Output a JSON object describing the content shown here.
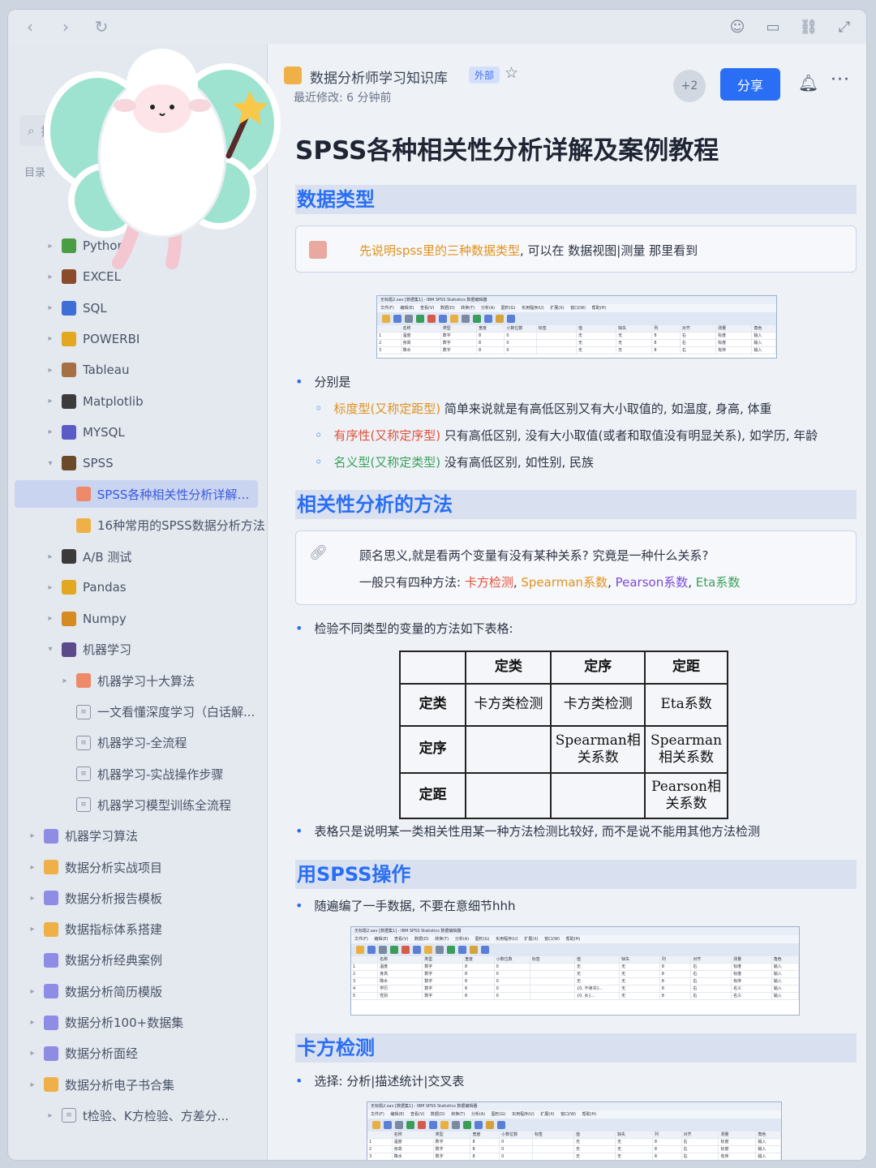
{
  "browser": {
    "back_icon": "back-icon",
    "forward_icon": "forward-icon",
    "refresh_icon": "refresh-icon"
  },
  "sidebar": {
    "search_label": "搜索",
    "toc_label": "目录",
    "items": [
      {
        "label": "Python",
        "level": 1,
        "arrow": "▸",
        "icon": "python-icon",
        "color": "#4a9d45"
      },
      {
        "label": "EXCEL",
        "level": 1,
        "arrow": "▸",
        "icon": "excel-icon",
        "color": "#8b4a2a"
      },
      {
        "label": "SQL",
        "level": 1,
        "arrow": "▸",
        "icon": "sql-icon",
        "color": "#3f6fd6"
      },
      {
        "label": "POWERBI",
        "level": 1,
        "arrow": "▸",
        "icon": "powerbi-icon",
        "color": "#e2a81f"
      },
      {
        "label": "Tableau",
        "level": 1,
        "arrow": "▸",
        "icon": "tableau-icon",
        "color": "#a57144"
      },
      {
        "label": "Matplotlib",
        "level": 1,
        "arrow": "▸",
        "icon": "matplotlib-icon",
        "color": "#3b3b3b"
      },
      {
        "label": "MYSQL",
        "level": 1,
        "arrow": "▸",
        "icon": "mysql-icon",
        "color": "#5b5bc8"
      },
      {
        "label": "SPSS",
        "level": 1,
        "arrow": "▾",
        "icon": "spss-icon",
        "color": "#6b4a2a"
      },
      {
        "label": "SPSS各种相关性分析详解及...",
        "level": 2,
        "arrow": "",
        "icon": "doc-orange-icon",
        "color": "#ee8a6a",
        "active": true
      },
      {
        "label": "16种常用的SPSS数据分析方法",
        "level": 2,
        "arrow": "",
        "icon": "doc-orange-icon",
        "color": "#f0b048"
      },
      {
        "label": "A/B 测试",
        "level": 1,
        "arrow": "▸",
        "icon": "ab-test-icon",
        "color": "#3b3b3b"
      },
      {
        "label": "Pandas",
        "level": 1,
        "arrow": "▸",
        "icon": "pandas-icon",
        "color": "#e2a81f"
      },
      {
        "label": "Numpy",
        "level": 1,
        "arrow": "▸",
        "icon": "numpy-icon",
        "color": "#d68a1f"
      },
      {
        "label": "机器学习",
        "level": 1,
        "arrow": "▾",
        "icon": "ml-icon",
        "color": "#5b4a8a"
      },
      {
        "label": "机器学习十大算法",
        "level": 2,
        "arrow": "▸",
        "icon": "doc-red-icon",
        "color": "#ee8a6a"
      },
      {
        "label": "一文看懂深度学习（白话解...",
        "level": 2,
        "arrow": "",
        "icon": "page-icon",
        "color": ""
      },
      {
        "label": "机器学习-全流程",
        "level": 2,
        "arrow": "",
        "icon": "page-icon",
        "color": ""
      },
      {
        "label": "机器学习-实战操作步骤",
        "level": 2,
        "arrow": "",
        "icon": "page-icon",
        "color": ""
      },
      {
        "label": "机器学习模型训练全流程",
        "level": 2,
        "arrow": "",
        "icon": "page-icon",
        "color": ""
      },
      {
        "label": "机器学习算法",
        "level": 0,
        "arrow": "▸",
        "icon": "folder-icon",
        "color": "#8f8ce6"
      },
      {
        "label": "数据分析实战项目",
        "level": 0,
        "arrow": "▸",
        "icon": "folder-icon",
        "color": "#f0b048"
      },
      {
        "label": "数据分析报告模板",
        "level": 0,
        "arrow": "▸",
        "icon": "folder-icon",
        "color": "#8f8ce6"
      },
      {
        "label": "数据指标体系搭建",
        "level": 0,
        "arrow": "▸",
        "icon": "folder-icon",
        "color": "#f0b048"
      },
      {
        "label": "数据分析经典案例",
        "level": 0,
        "arrow": "",
        "icon": "folder-icon",
        "color": "#8f8ce6"
      },
      {
        "label": "数据分析简历模版",
        "level": 0,
        "arrow": "▸",
        "icon": "folder-icon",
        "color": "#8f8ce6"
      },
      {
        "label": "数据分析100+数据集",
        "level": 0,
        "arrow": "▸",
        "icon": "folder-icon",
        "color": "#8f8ce6"
      },
      {
        "label": "数据分析面经",
        "level": 0,
        "arrow": "▸",
        "icon": "folder-icon",
        "color": "#8f8ce6"
      },
      {
        "label": "数据分析电子书合集",
        "level": 0,
        "arrow": "▸",
        "icon": "folder-icon",
        "color": "#f0b048"
      },
      {
        "label": "t检验、K方检验、方差分...",
        "level": 1,
        "arrow": "▸",
        "icon": "page-icon",
        "color": ""
      }
    ]
  },
  "header": {
    "kb_title": "数据分析师学习知识库",
    "kb_tag": "外部",
    "last_modified": "最近修改: 6 分钟前",
    "collab_count": "+2",
    "share_label": "分享"
  },
  "doc": {
    "title": "SPSS各种相关性分析详解及案例教程",
    "s1": {
      "heading": "数据类型",
      "callout_hl": "先说明spss里的三种数据类型",
      "callout_rest": ", 可以在 数据视图|测量 那里看到",
      "bullet": "分别是",
      "sub1_hl": "标度型(又称定距型)",
      "sub1_rest": " 简单来说就是有高低区别又有大小取值的, 如温度, 身高, 体重",
      "sub2_hl": "有序性(又称定序型)",
      "sub2_rest": " 只有高低区别, 没有大小取值(或者和取值没有明显关系), 如学历, 年龄",
      "sub3_hl": "名义型(又称定类型)",
      "sub3_rest": " 没有高低区别, 如性别, 民族"
    },
    "s2": {
      "heading": "相关性分析的方法",
      "line1": "顾名思义,就是看两个变量有没有某种关系? 究竟是一种什么关系?",
      "line2_pre": "一般只有四种方法: ",
      "m1": "卡方检测",
      "m2": "Spearman系数",
      "m3": "Pearson系数",
      "m4": "Eta系数",
      "sep": ", ",
      "bullet": "检验不同类型的变量的方法如下表格:",
      "note": "表格只是说明某一类相关性用某一种方法检测比较好, 而不是说不能用其他方法检测"
    },
    "matrix": {
      "col_headers": [
        "",
        "定类",
        "定序",
        "定距"
      ],
      "rows": [
        [
          "定类",
          "卡方类检测",
          "卡方类检测",
          "Eta系数"
        ],
        [
          "定序",
          "",
          "Spearman相关系数",
          "Spearman相关系数"
        ],
        [
          "定距",
          "",
          "",
          "Pearson相关系数"
        ]
      ]
    },
    "s3": {
      "heading": "用SPSS操作",
      "bullet": "随遍编了一手数据, 不要在意细节hhh"
    },
    "s4": {
      "heading": "卡方检测",
      "bullet": "选择: 分析|描述统计|交叉表"
    },
    "spss": {
      "titlebar": "无标题2.sav [数据集1] - IBM SPSS Statistics 数据编辑器",
      "menubar": "文件(F) 编辑(E) 查看(V) 数据(D) 转换(T) 分析(A) 图形(G) 实用程序(U) 扩展(X) 窗口(W) 帮助(H)",
      "head": [
        "",
        "名称",
        "类型",
        "宽度",
        "小数位数",
        "标签",
        "值",
        "缺失",
        "列",
        "对齐",
        "测量",
        "角色"
      ],
      "rows": [
        [
          "1",
          "温度",
          "数字",
          "8",
          "0",
          "",
          "无",
          "无",
          "8",
          "右",
          "标度",
          "输入"
        ],
        [
          "2",
          "身高",
          "数字",
          "8",
          "0",
          "",
          "无",
          "无",
          "8",
          "右",
          "标度",
          "输入"
        ],
        [
          "3",
          "降水",
          "数字",
          "8",
          "0",
          "",
          "无",
          "无",
          "8",
          "右",
          "有序",
          "输入"
        ],
        [
          "4",
          "学历",
          "数字",
          "8",
          "0",
          "",
          "{0, 不读书}...",
          "无",
          "8",
          "右",
          "名义",
          "输入"
        ],
        [
          "5",
          "性别",
          "数字",
          "8",
          "0",
          "",
          "{0, 女}...",
          "无",
          "8",
          "右",
          "名义",
          "输入"
        ]
      ]
    }
  }
}
